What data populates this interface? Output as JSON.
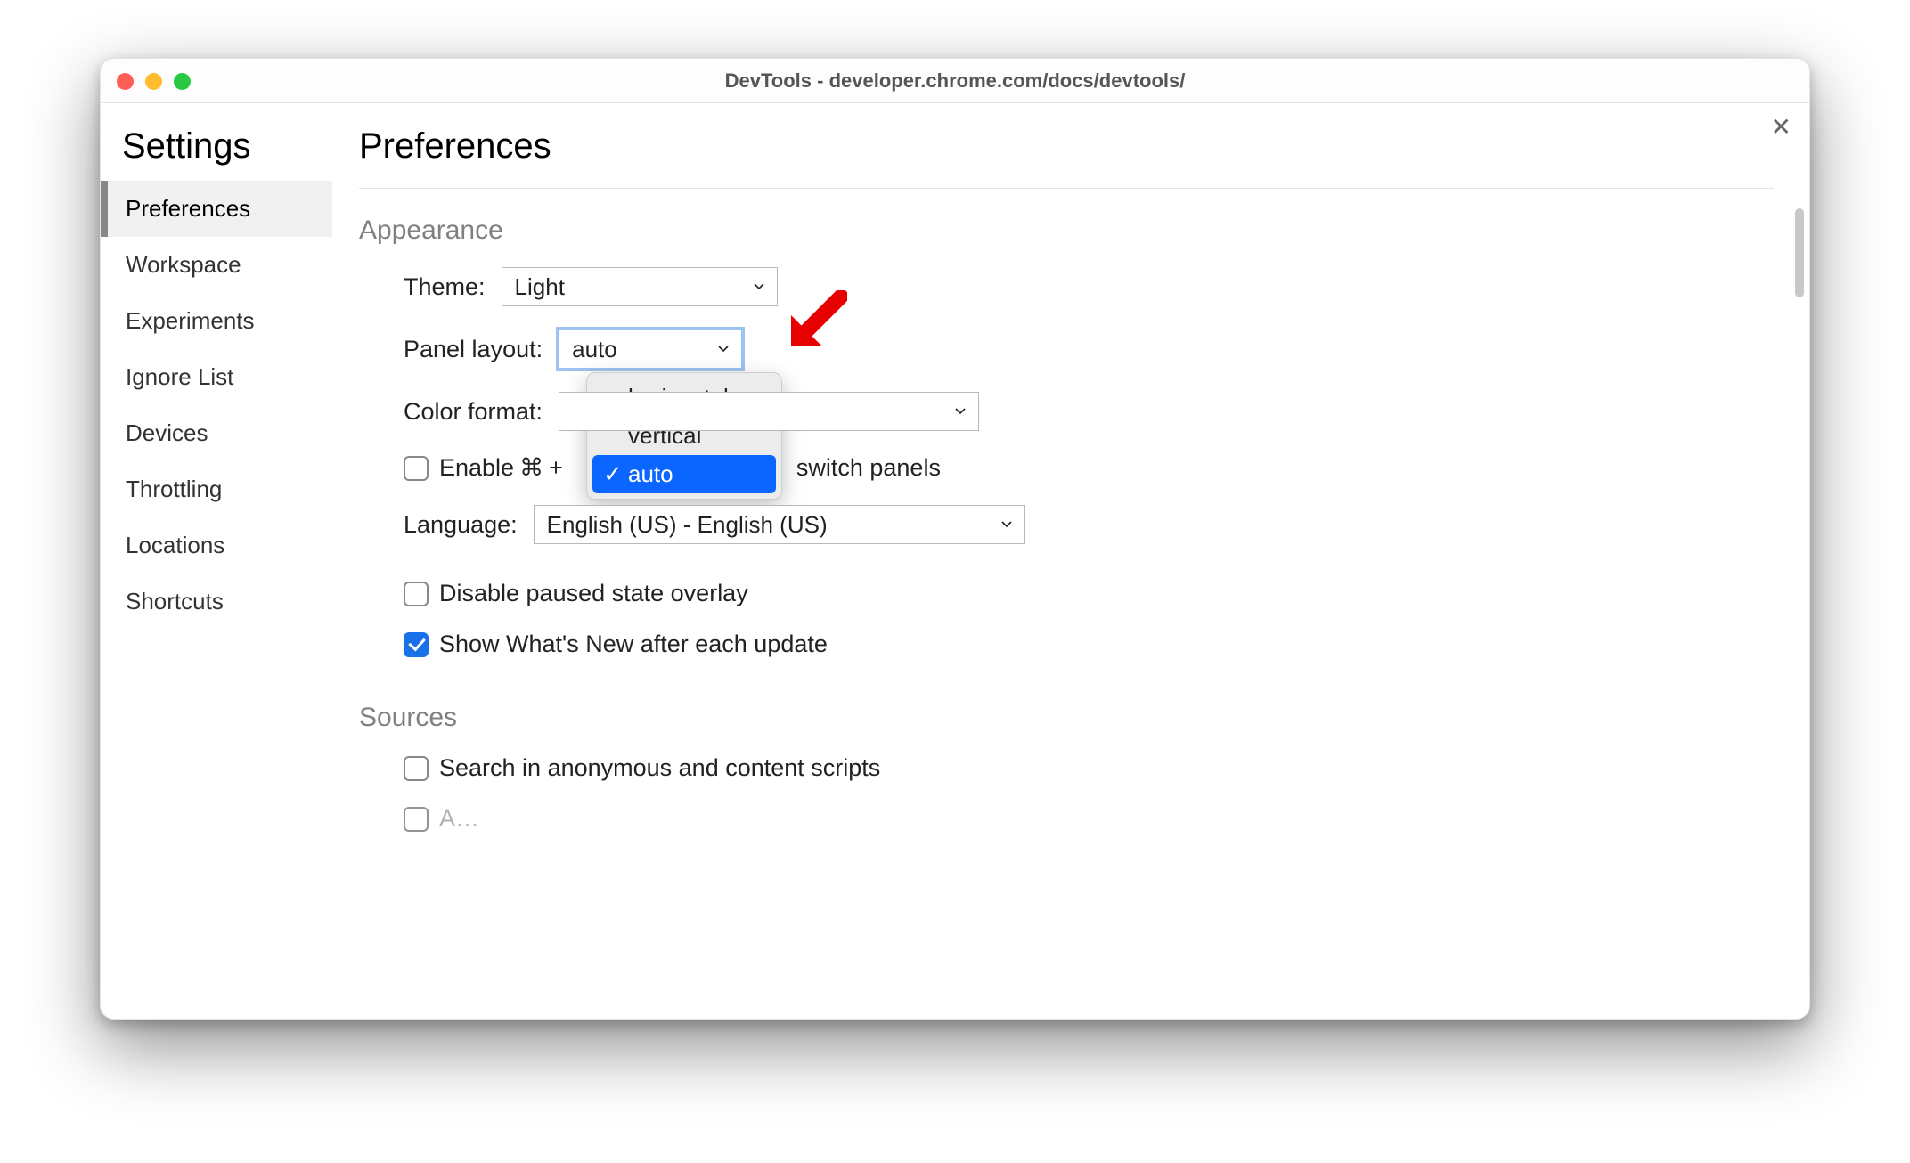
{
  "window": {
    "title": "DevTools - developer.chrome.com/docs/devtools/"
  },
  "settings_title": "Settings",
  "sidebar": {
    "items": [
      {
        "label": "Preferences",
        "active": true
      },
      {
        "label": "Workspace"
      },
      {
        "label": "Experiments"
      },
      {
        "label": "Ignore List"
      },
      {
        "label": "Devices"
      },
      {
        "label": "Throttling"
      },
      {
        "label": "Locations"
      },
      {
        "label": "Shortcuts"
      }
    ]
  },
  "main": {
    "title": "Preferences",
    "appearance": {
      "heading": "Appearance",
      "theme_label": "Theme:",
      "theme_value": "Light",
      "panel_label": "Panel layout:",
      "panel_value": "auto",
      "panel_options": [
        "horizontal",
        "vertical",
        "auto"
      ],
      "panel_selected": "auto",
      "color_label": "Color format:",
      "color_value": "",
      "enable_shortcut_prefix": "Enable",
      "enable_shortcut_cmd": "⌘",
      "enable_shortcut_plus": "+",
      "enable_shortcut_suffix": "switch panels",
      "language_label": "Language:",
      "language_value": "English (US) - English (US)",
      "disable_overlay_label": "Disable paused state overlay",
      "whatsnew_label": "Show What's New after each update"
    },
    "sources": {
      "heading": "Sources",
      "search_anon_label": "Search in anonymous and content scripts"
    }
  }
}
